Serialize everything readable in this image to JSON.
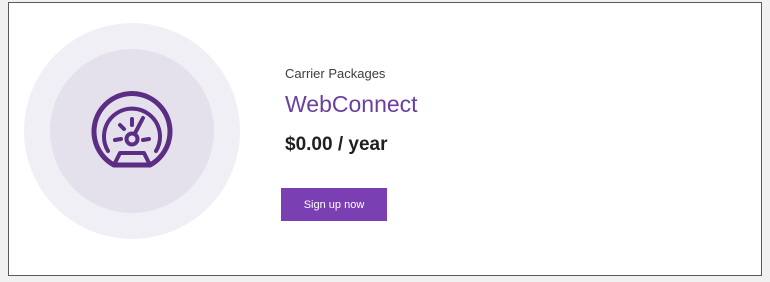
{
  "card": {
    "icon": "speedometer-icon",
    "eyebrow": "Carrier Packages",
    "product_name": "WebConnect",
    "price": "$0.00 / year",
    "cta_label": "Sign up now"
  },
  "colors": {
    "accent": "#6b3fa0",
    "button": "#7a3fb2",
    "outer_circle": "#f1eff6",
    "inner_circle": "#e4e0ec",
    "icon_stroke": "#5b2d83"
  }
}
